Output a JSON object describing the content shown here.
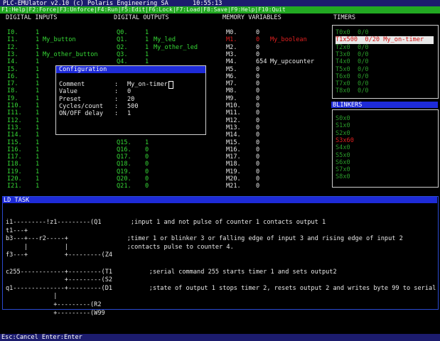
{
  "titlebar": {
    "app": "PLC-EMUlator v2.10 (c) Polaris Engineering SA",
    "time": "10:55:13"
  },
  "menubar": "F1:Help|F2:Force|F3:Unforce|F4:Run|F5:Edit|F6:Lock|F7:Load|F8:Save|F9:Help|F10:Quit",
  "headers": {
    "inputs": "DIGITAL INPUTS",
    "outputs": "DIGITAL OUTPUTS",
    "memory": "MEMORY VARIABLES",
    "timers": "TIMERS",
    "blinkers": "BLINKERS",
    "ld": "LD TASK"
  },
  "inputs": [
    {
      "id": "I0.",
      "val": "1",
      "name": ""
    },
    {
      "id": "I1.",
      "val": "1",
      "name": "My_button"
    },
    {
      "id": "I2.",
      "val": "1",
      "name": ""
    },
    {
      "id": "I3.",
      "val": "1",
      "name": "My_other_button"
    },
    {
      "id": "I4.",
      "val": "1",
      "name": ""
    },
    {
      "id": "I5.",
      "val": "1",
      "name": ""
    },
    {
      "id": "I6.",
      "val": "1",
      "name": ""
    },
    {
      "id": "I7.",
      "val": "1",
      "name": ""
    },
    {
      "id": "I8.",
      "val": "1",
      "name": ""
    },
    {
      "id": "I9.",
      "val": "1",
      "name": ""
    },
    {
      "id": "I10.",
      "val": "1",
      "name": ""
    },
    {
      "id": "I11.",
      "val": "1",
      "name": ""
    },
    {
      "id": "I12.",
      "val": "1",
      "name": ""
    },
    {
      "id": "I13.",
      "val": "1",
      "name": ""
    },
    {
      "id": "I14.",
      "val": "1",
      "name": ""
    },
    {
      "id": "I15.",
      "val": "1",
      "name": ""
    },
    {
      "id": "I16.",
      "val": "1",
      "name": ""
    },
    {
      "id": "I17.",
      "val": "1",
      "name": ""
    },
    {
      "id": "I18.",
      "val": "1",
      "name": ""
    },
    {
      "id": "I19.",
      "val": "1",
      "name": ""
    },
    {
      "id": "I20.",
      "val": "1",
      "name": ""
    },
    {
      "id": "I21.",
      "val": "1",
      "name": ""
    }
  ],
  "outputs": [
    {
      "id": "Q0.",
      "val": "1",
      "name": ""
    },
    {
      "id": "Q1.",
      "val": "1",
      "name": "My_led"
    },
    {
      "id": "Q2.",
      "val": "1",
      "name": "My_other_led"
    },
    {
      "id": "Q3.",
      "val": "1",
      "name": ""
    },
    {
      "id": "Q4.",
      "val": "1",
      "name": ""
    },
    {
      "id": "Q15.",
      "val": "1",
      "name": ""
    },
    {
      "id": "Q16.",
      "val": "0",
      "name": ""
    },
    {
      "id": "Q17.",
      "val": "0",
      "name": ""
    },
    {
      "id": "Q18.",
      "val": "0",
      "name": ""
    },
    {
      "id": "Q19.",
      "val": "0",
      "name": ""
    },
    {
      "id": "Q20.",
      "val": "0",
      "name": ""
    },
    {
      "id": "Q21.",
      "val": "0",
      "name": ""
    }
  ],
  "memory": [
    {
      "id": "M0.",
      "val": "0",
      "name": ""
    },
    {
      "id": "M1.",
      "val": "0",
      "name": "My_boolean"
    },
    {
      "id": "M2.",
      "val": "0",
      "name": ""
    },
    {
      "id": "M3.",
      "val": "0",
      "name": ""
    },
    {
      "id": "M4.",
      "val": "654",
      "name": "My_upcounter"
    },
    {
      "id": "M5.",
      "val": "0",
      "name": ""
    },
    {
      "id": "M6.",
      "val": "0",
      "name": ""
    },
    {
      "id": "M7.",
      "val": "0",
      "name": ""
    },
    {
      "id": "M8.",
      "val": "0",
      "name": ""
    },
    {
      "id": "M9.",
      "val": "0",
      "name": ""
    },
    {
      "id": "M10.",
      "val": "0",
      "name": ""
    },
    {
      "id": "M11.",
      "val": "0",
      "name": ""
    },
    {
      "id": "M12.",
      "val": "0",
      "name": ""
    },
    {
      "id": "M13.",
      "val": "0",
      "name": ""
    },
    {
      "id": "M14.",
      "val": "0",
      "name": ""
    },
    {
      "id": "M15.",
      "val": "0",
      "name": ""
    },
    {
      "id": "M16.",
      "val": "0",
      "name": ""
    },
    {
      "id": "M17.",
      "val": "0",
      "name": ""
    },
    {
      "id": "M18.",
      "val": "0",
      "name": ""
    },
    {
      "id": "M19.",
      "val": "0",
      "name": ""
    },
    {
      "id": "M20.",
      "val": "0",
      "name": ""
    },
    {
      "id": "M21.",
      "val": "0",
      "name": ""
    }
  ],
  "timers": [
    "T0x0  0/0",
    "T1x500  0/20 My_on-timer",
    "T2x0  0/0",
    "T3x0  0/0",
    "T4x0  0/0",
    "T5x0  0/0",
    "T6x0  0/0",
    "T7x0  0/0",
    "T8x0  0/0"
  ],
  "blinkers": [
    "S0x0",
    "S1x0",
    "S2x0",
    "S3x60",
    "S4x0",
    "S5x0",
    "S6x0",
    "S7x0",
    "S8x0"
  ],
  "dialog": {
    "title": "Configuration",
    "fields": [
      {
        "label": "Comment",
        "value": "My_on-timer"
      },
      {
        "label": "Value",
        "value": "0"
      },
      {
        "label": "Preset",
        "value": "20"
      },
      {
        "label": "Cycles/count",
        "value": "500"
      },
      {
        "label": "ON/OFF delay",
        "value": "1"
      }
    ]
  },
  "ld_lines": [
    "i1---------!z1---------(Q1        ;input 1 and not pulse of counter 1 contacts output 1",
    "t1---+",
    "b3---+---r2-----+                ;timer 1 or blinker 3 or falling edge of input 3 and rising edge of input 2",
    "     |          |                ;contacts pulse to counter 4.",
    "f3---+          +---------(Z4",
    "",
    "c255------------+---------(T1          ;serial command 255 starts timer 1 and sets output2",
    "                +---------(S2",
    "q1--------------+---------(D1          ;state of output 1 stops timer 2, resets output 2 and writes byte 99 to serial o",
    "             |",
    "             +---------(R2",
    "             +---------(W99"
  ],
  "status": "Esc:Cancel  Enter:Enter"
}
